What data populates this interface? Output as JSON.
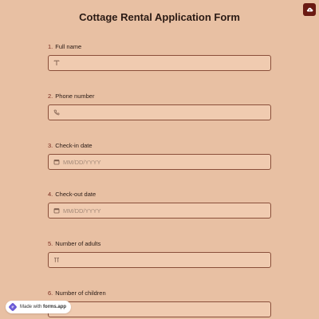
{
  "form": {
    "title": "Cottage Rental Application Form"
  },
  "questions": [
    {
      "number": "1.",
      "label": "Full name",
      "value": "",
      "icon": "text-icon"
    },
    {
      "number": "2.",
      "label": "Phone number",
      "value": "",
      "icon": "phone-icon"
    },
    {
      "number": "3.",
      "label": "Check-in date",
      "value": "MM/DD/YYYY",
      "icon": "calendar-icon"
    },
    {
      "number": "4.",
      "label": "Check-out date",
      "value": "MM/DD/YYYY",
      "icon": "calendar-icon"
    },
    {
      "number": "5.",
      "label": "Number of adults",
      "value": "",
      "icon": "number-icon"
    },
    {
      "number": "6.",
      "label": "Number of children",
      "value": "",
      "icon": "number-icon"
    }
  ],
  "badge": {
    "prefix": "Made with",
    "brand": "forms.app"
  },
  "colors": {
    "background": "#e8c0a3",
    "input_background": "#f0cbb0",
    "input_border": "#8a4f3a",
    "accent": "#6a1a12"
  }
}
